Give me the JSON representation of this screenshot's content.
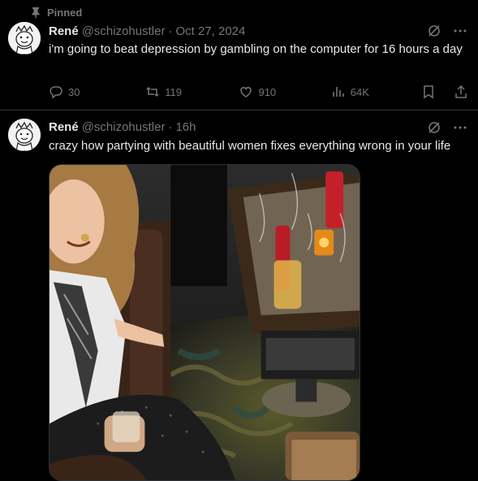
{
  "pinned_label": "Pinned",
  "tweets": [
    {
      "name": "René",
      "handle": "@schizohustler",
      "separator": "·",
      "timestamp": "Oct 27, 2024",
      "text": "i'm going to beat depression by gambling on the computer for 16 hours a day",
      "replies": "30",
      "retweets": "119",
      "likes": "910",
      "views": "64K"
    },
    {
      "name": "René",
      "handle": "@schizohustler",
      "separator": "·",
      "timestamp": "16h",
      "text": "crazy how partying with beautiful women fixes everything wrong in your life"
    }
  ],
  "icons": [
    "pin-icon",
    "avatar",
    "grok-icon",
    "more-icon",
    "reply-icon",
    "retweet-icon",
    "like-icon",
    "views-icon",
    "bookmark-icon",
    "share-icon"
  ],
  "colors": {
    "background": "#000000",
    "text": "#e7e9ea",
    "muted": "#71767b",
    "divider": "#2f3336"
  }
}
